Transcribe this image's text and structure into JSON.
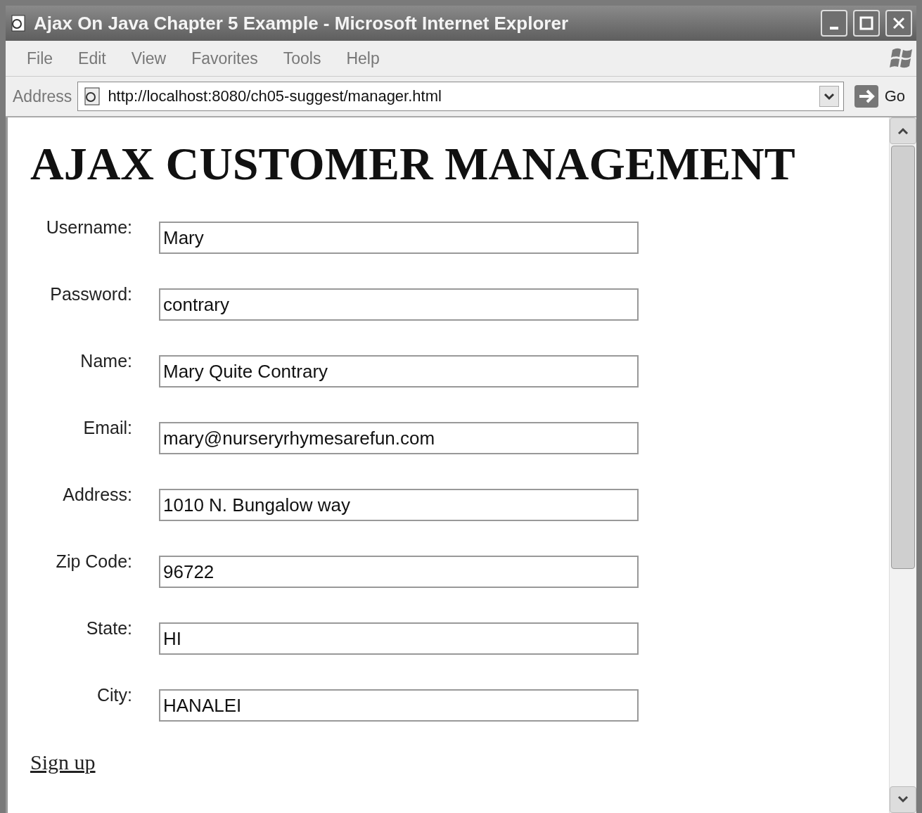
{
  "window": {
    "title": "Ajax On Java Chapter 5 Example - Microsoft Internet Explorer"
  },
  "menu": [
    "File",
    "Edit",
    "View",
    "Favorites",
    "Tools",
    "Help"
  ],
  "address_bar": {
    "label": "Address",
    "url": "http://localhost:8080/ch05-suggest/manager.html",
    "go": "Go"
  },
  "page": {
    "heading": "AJAX CUSTOMER MANAGEMENT",
    "fields": [
      {
        "label": "Username:",
        "value": "Mary"
      },
      {
        "label": "Password:",
        "value": "contrary"
      },
      {
        "label": "Name:",
        "value": "Mary Quite Contrary"
      },
      {
        "label": "Email:",
        "value": "mary@nurseryrhymesarefun.com"
      },
      {
        "label": "Address:",
        "value": "1010 N. Bungalow way"
      },
      {
        "label": "Zip Code:",
        "value": "96722"
      },
      {
        "label": "State:",
        "value": "HI"
      },
      {
        "label": "City:",
        "value": "HANALEI"
      }
    ],
    "link": "Sign up"
  }
}
